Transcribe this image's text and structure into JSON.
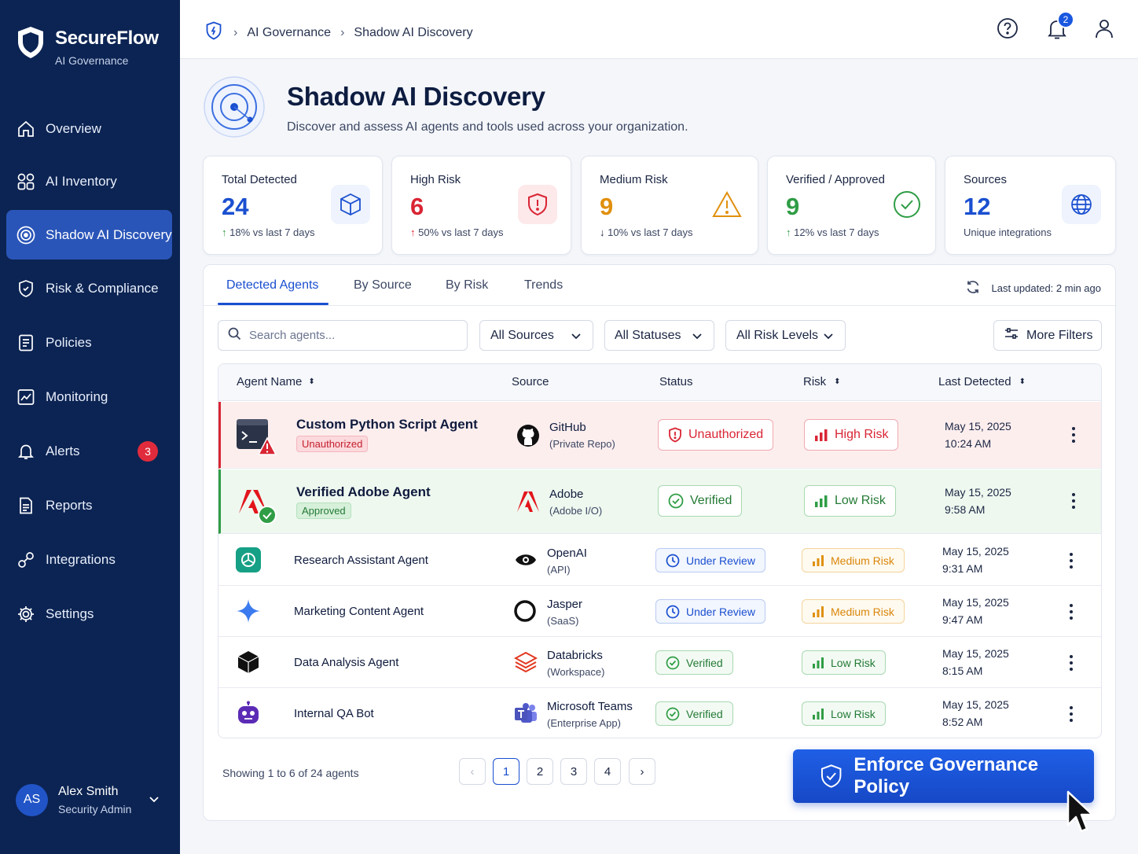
{
  "brand": {
    "name": "SecureFlow",
    "subtitle": "AI Governance"
  },
  "nav": {
    "items": [
      {
        "label": "Overview",
        "icon": "home-icon"
      },
      {
        "label": "AI Inventory",
        "icon": "grid-icon"
      },
      {
        "label": "Shadow AI Discovery",
        "icon": "radar-icon",
        "active": true
      },
      {
        "label": "Risk & Compliance",
        "icon": "shield-icon"
      },
      {
        "label": "Policies",
        "icon": "document-icon"
      },
      {
        "label": "Monitoring",
        "icon": "chart-icon"
      },
      {
        "label": "Alerts",
        "icon": "bell-icon",
        "badge": "3"
      },
      {
        "label": "Reports",
        "icon": "report-icon"
      },
      {
        "label": "Integrations",
        "icon": "link-icon"
      },
      {
        "label": "Settings",
        "icon": "gear-icon"
      }
    ]
  },
  "user": {
    "initials": "AS",
    "name": "Alex Smith",
    "role": "Security Admin"
  },
  "breadcrumb": {
    "parent": "AI Governance",
    "current": "Shadow AI Discovery"
  },
  "topbar": {
    "notification_count": "2"
  },
  "header": {
    "title": "Shadow AI Discovery",
    "subtitle": "Discover and assess AI agents and tools used across your organization."
  },
  "stats": [
    {
      "label": "Total Detected",
      "value": "24",
      "trend": "18% vs last 7 days",
      "color": "#1a4fd0",
      "icon": "cube-icon"
    },
    {
      "label": "High Risk",
      "value": "6",
      "trend": "50% vs last 7 days",
      "color": "#d92534",
      "icon": "shield-alert-icon"
    },
    {
      "label": "Medium Risk",
      "value": "9",
      "trend": "10% vs last 7 days",
      "color": "#e0900e",
      "icon": "warning-icon"
    },
    {
      "label": "Verified / Approved",
      "value": "9",
      "trend": "12% vs last 7 days",
      "color": "#2f9d45",
      "icon": "check-circle-icon"
    },
    {
      "label": "Sources",
      "value": "12",
      "trend": "Unique integrations",
      "color": "#1a4fd0",
      "icon": "globe-icon"
    }
  ],
  "tabs": [
    "Detected Agents",
    "By Source",
    "By Risk",
    "Trends"
  ],
  "last_updated": "Last updated: 2 min ago",
  "filters": {
    "search_placeholder": "Search agents...",
    "sources": "All Sources",
    "statuses": "All Statuses",
    "risk_levels": "All Risk Levels",
    "more": "More Filters"
  },
  "columns": {
    "agent": "Agent Name",
    "source": "Source",
    "status": "Status",
    "risk": "Risk",
    "last": "Last Detected"
  },
  "rows": [
    {
      "name": "Custom Python Script Agent",
      "tag": "Unauthorized",
      "source": "GitHub",
      "source_sub": "(Private Repo)",
      "status": "Unauthorized",
      "risk": "High Risk",
      "date": "May 15, 2025",
      "time": "10:24 AM"
    },
    {
      "name": "Verified Adobe Agent",
      "tag": "Approved",
      "source": "Adobe",
      "source_sub": "(Adobe I/O)",
      "status": "Verified",
      "risk": "Low Risk",
      "date": "May 15, 2025",
      "time": "9:58 AM"
    },
    {
      "name": "Research Assistant Agent",
      "source": "OpenAI",
      "source_sub": "(API)",
      "status": "Under Review",
      "risk": "Medium Risk",
      "date": "May 15, 2025",
      "time": "9:31 AM"
    },
    {
      "name": "Marketing Content Agent",
      "source": "Jasper",
      "source_sub": "(SaaS)",
      "status": "Under Review",
      "risk": "Medium Risk",
      "date": "May 15, 2025",
      "time": "9:47 AM"
    },
    {
      "name": "Data Analysis Agent",
      "source": "Databricks",
      "source_sub": "(Workspace)",
      "status": "Verified",
      "risk": "Low Risk",
      "date": "May 15, 2025",
      "time": "8:15 AM"
    },
    {
      "name": "Internal QA Bot",
      "source": "Microsoft Teams",
      "source_sub": "(Enterprise App)",
      "status": "Verified",
      "risk": "Low Risk",
      "date": "May 15, 2025",
      "time": "8:52 AM"
    }
  ],
  "pagination": {
    "summary": "Showing 1 to 6 of 24 agents",
    "pages": [
      "1",
      "2",
      "3",
      "4"
    ],
    "current": "1"
  },
  "cta": {
    "label": "Enforce Governance Policy"
  }
}
